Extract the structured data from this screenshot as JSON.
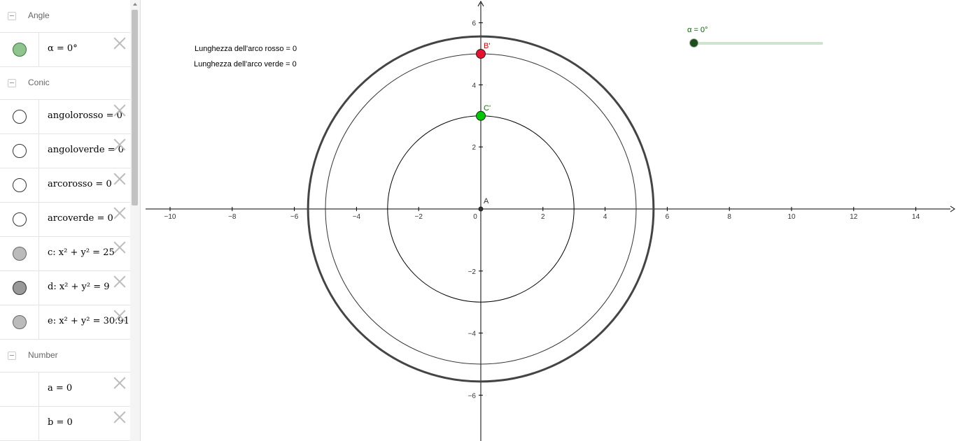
{
  "algebra": {
    "groups": [
      {
        "label": "Angle",
        "items": [
          {
            "expr": "α = 0°",
            "marble": "#8fc48f",
            "marble_border": "#3a7a3a"
          }
        ]
      },
      {
        "label": "Conic",
        "items": [
          {
            "expr": "angolorosso = 0",
            "marble": "#ffffff",
            "marble_border": "#333333"
          },
          {
            "expr": "angoloverde = 0",
            "marble": "#ffffff",
            "marble_border": "#333333"
          },
          {
            "expr": "arcorosso = 0",
            "marble": "#ffffff",
            "marble_border": "#333333"
          },
          {
            "expr": "arcoverde = 0",
            "marble": "#ffffff",
            "marble_border": "#333333"
          },
          {
            "expr": "c: x² + y² = 25",
            "marble": "#bbbbbb",
            "marble_border": "#666666"
          },
          {
            "expr": "d: x² + y² = 9",
            "marble": "#999999",
            "marble_border": "#333333"
          },
          {
            "expr": "e: x² + y² = 30.91",
            "marble": "#bbbbbb",
            "marble_border": "#666666"
          }
        ]
      },
      {
        "label": "Number",
        "items": [
          {
            "expr": "a = 0",
            "marble": null
          },
          {
            "expr": "b = 0",
            "marble": null
          }
        ]
      }
    ]
  },
  "graphics": {
    "arc_texts": [
      "Lunghezza dell'arco rosso = 0",
      "Lunghezza dell'arco verde = 0"
    ],
    "slider": {
      "label": "α = 0°",
      "value": 0
    },
    "axes": {
      "x_ticks": [
        "−10",
        "−8",
        "−6",
        "−4",
        "−2",
        "0",
        "2",
        "4",
        "6",
        "8",
        "10",
        "12",
        "14"
      ],
      "y_ticks": [
        "6",
        "4",
        "2",
        "−2",
        "−4",
        "−6"
      ]
    },
    "points": [
      {
        "name": "A",
        "x": 0,
        "y": 0,
        "color": "#333333",
        "label_color": "#333333"
      },
      {
        "name": "B'",
        "x": 0,
        "y": 5,
        "color": "#e8112d",
        "label_color": "#cc0000"
      },
      {
        "name": "C'",
        "x": 0,
        "y": 3,
        "color": "#00c800",
        "label_color": "#008000"
      }
    ],
    "circles": [
      {
        "name": "c",
        "r": 5,
        "color": "#333333"
      },
      {
        "name": "d",
        "r": 3,
        "color": "#000000"
      },
      {
        "name": "e",
        "r": 5.56,
        "color": "#444444"
      }
    ],
    "colors": {
      "axis": "#000000",
      "slider_accent": "#006400"
    }
  }
}
